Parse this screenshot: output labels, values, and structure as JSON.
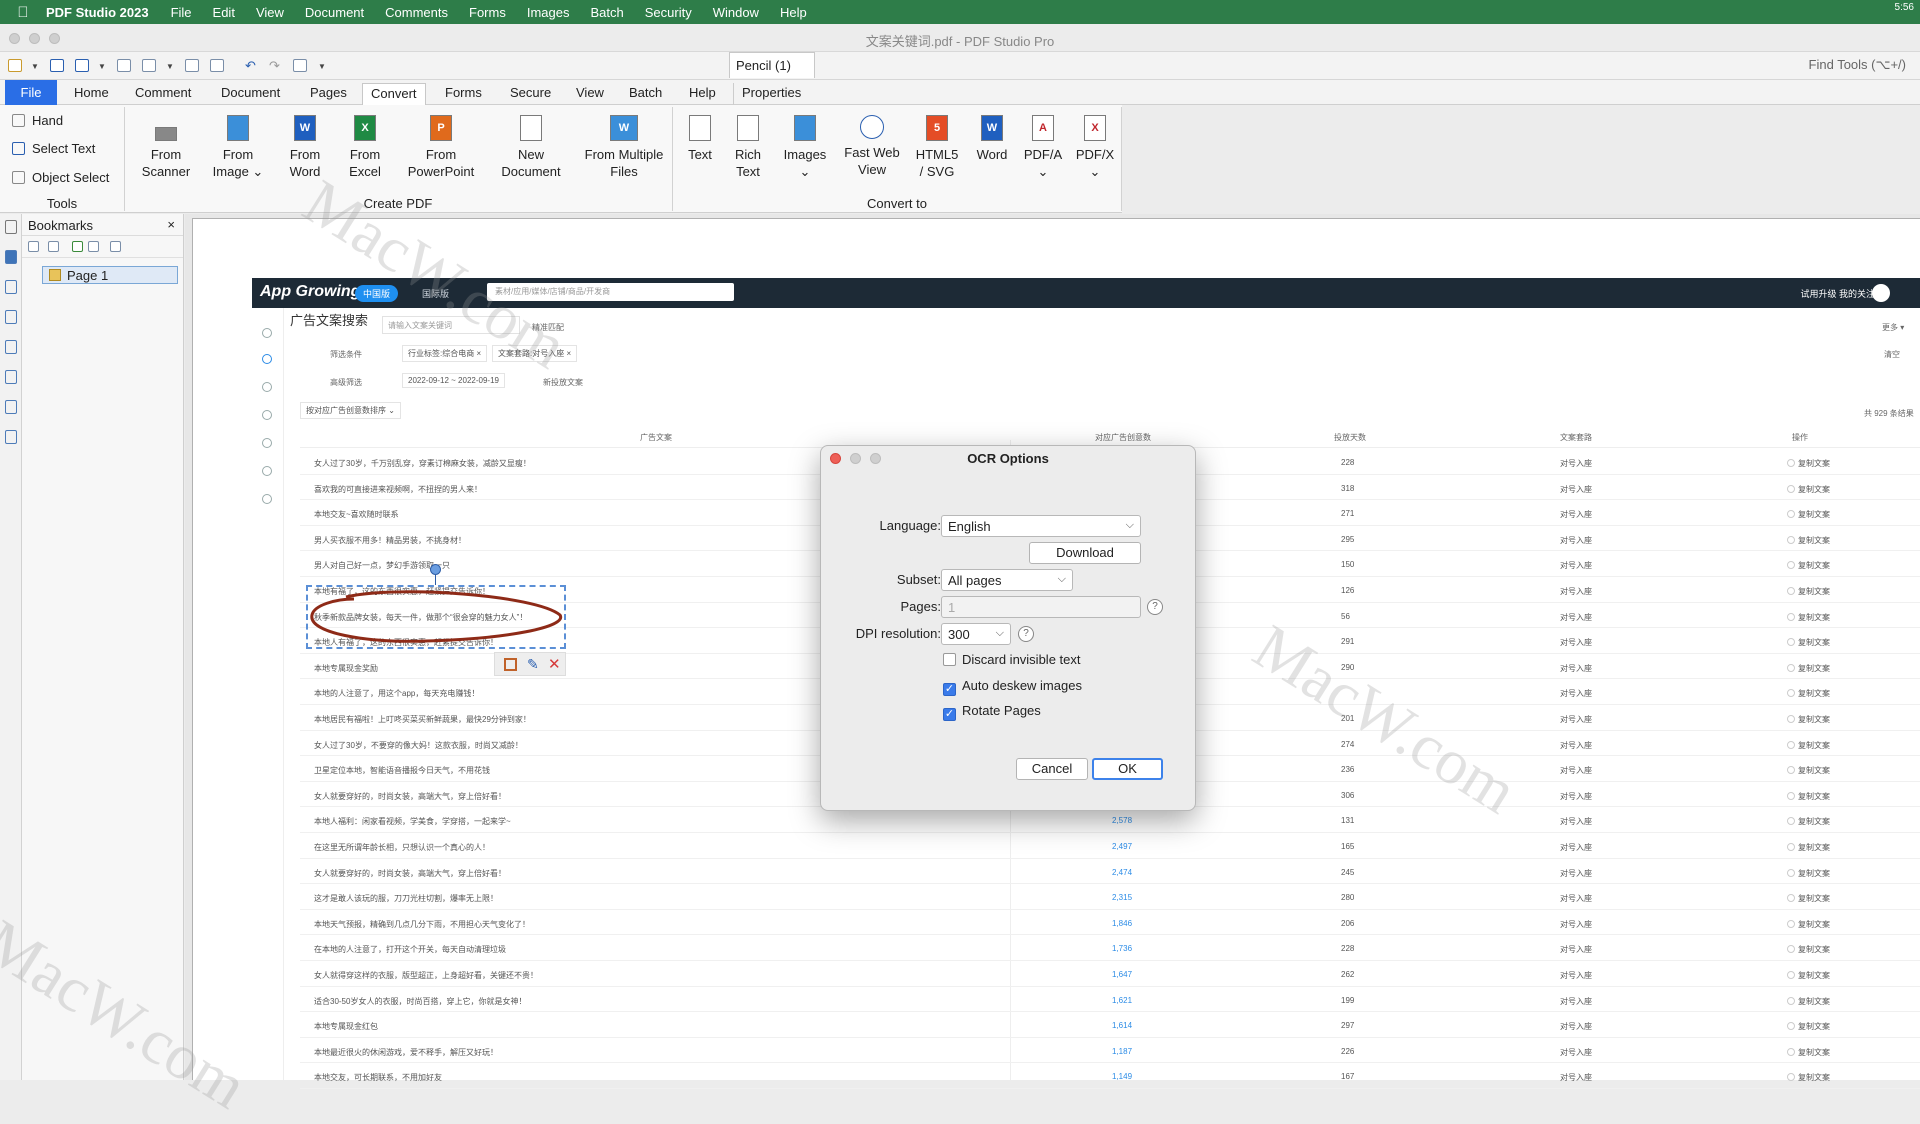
{
  "menubar": {
    "app_name": "PDF Studio 2023",
    "items": [
      "File",
      "Edit",
      "View",
      "Document",
      "Comments",
      "Forms",
      "Images",
      "Batch",
      "Security",
      "Window",
      "Help"
    ],
    "clock": "5:56"
  },
  "window": {
    "title": "文案关键词.pdf - PDF Studio Pro"
  },
  "quick": {
    "pencil_tab": "Pencil (1)",
    "find_tools": "Find Tools  (⌥+/)"
  },
  "tabs": [
    "File",
    "Home",
    "Comment",
    "Document",
    "Pages",
    "Convert",
    "Forms",
    "Secure",
    "View",
    "Batch",
    "Help",
    "Properties"
  ],
  "ribbon": {
    "tools": [
      "Hand",
      "Select Text",
      "Object Select"
    ],
    "tools_group": "Tools",
    "create_buttons": [
      {
        "line1": "From",
        "line2": "Scanner"
      },
      {
        "line1": "From",
        "line2": "Image ⌄"
      },
      {
        "line1": "From",
        "line2": "Word"
      },
      {
        "line1": "From",
        "line2": "Excel"
      },
      {
        "line1": "From",
        "line2": "PowerPoint"
      },
      {
        "line1": "New",
        "line2": "Document"
      },
      {
        "line1": "From Multiple",
        "line2": "Files"
      }
    ],
    "create_group": "Create PDF",
    "convert_buttons": [
      {
        "line1": "Text",
        "line2": ""
      },
      {
        "line1": "Rich",
        "line2": "Text"
      },
      {
        "line1": "Images",
        "line2": "⌄"
      },
      {
        "line1": "Fast Web",
        "line2": "View"
      },
      {
        "line1": "HTML5",
        "line2": "/ SVG"
      },
      {
        "line1": "Word",
        "line2": ""
      },
      {
        "line1": "PDF/A",
        "line2": "⌄"
      },
      {
        "line1": "PDF/X",
        "line2": "⌄"
      }
    ],
    "convert_group": "Convert to"
  },
  "bookmarks": {
    "title": "Bookmarks",
    "close": "×",
    "page_label": "Page 1"
  },
  "web": {
    "logo": "App Growing",
    "pill": "中国版",
    "intl": "国际版",
    "search_placeholder": "素材/应用/媒体/店铺/商品/开发商",
    "right_links": "试用升级   我的关注 ▾",
    "heading": "广告文案搜索",
    "input_placeholder": "请输入文案关键词",
    "toggle_label": "精准匹配",
    "more": "更多 ▾",
    "filter_label": "筛选条件",
    "filter_tags": [
      "行业标签:综合电商 ×",
      "文案套路:对号入座 ×"
    ],
    "clear": "清空",
    "advanced_label": "高级筛选",
    "date_range": "2022-09-12 ~ 2022-09-19",
    "new_copy": "新投放文案",
    "sort": "按对应广告创意数排序 ⌄",
    "total": "共 929 条结果",
    "columns": [
      "广告文案",
      "对应广告创意数",
      "投放天数",
      "文案套路",
      "操作"
    ]
  },
  "rows": [
    {
      "text": "女人过了30岁，千万别乱穿，穿素订棉麻女装，减龄又显瘦！",
      "count": "",
      "days": "228",
      "type": "对号入座",
      "op": "复制文案"
    },
    {
      "text": "喜欢我的可直接进来视频啊，不扭捏的男人来！",
      "count": "",
      "days": "318",
      "type": "对号入座",
      "op": "复制文案"
    },
    {
      "text": "本地交友~喜欢随时联系",
      "count": "",
      "days": "271",
      "type": "对号入座",
      "op": "复制文案"
    },
    {
      "text": "男人买衣服不用多！精品男装，不挑身材！",
      "count": "",
      "days": "295",
      "type": "对号入座",
      "op": "复制文案"
    },
    {
      "text": "男人对自己好一点，梦幻手游领取一只",
      "count": "",
      "days": "150",
      "type": "对号入座",
      "op": "复制文案"
    },
    {
      "text": "本地有福了，这的东西很实惠，赶紧提交告诉你！",
      "count": "",
      "days": "126",
      "type": "对号入座",
      "op": "复制文案"
    },
    {
      "text": "秋季新款品牌女装，每天一件，做那个“很会穿的魅力女人”！",
      "count": "",
      "days": "56",
      "type": "对号入座",
      "op": "复制文案"
    },
    {
      "text": "本地人有福了，这的东西很实惠，赶紧提交告诉你！",
      "count": "",
      "days": "291",
      "type": "对号入座",
      "op": "复制文案"
    },
    {
      "text": "本地专属现金奖励",
      "count": "",
      "days": "290",
      "type": "对号入座",
      "op": "复制文案"
    },
    {
      "text": "本地的人注意了，用这个app，每天充电赚钱！",
      "count": "",
      "days": "",
      "type": "对号入座",
      "op": "复制文案"
    },
    {
      "text": "本地居民有福啦！上叮咚买菜买新鲜蔬果，最快29分钟到家！",
      "count": "",
      "days": "201",
      "type": "对号入座",
      "op": "复制文案"
    },
    {
      "text": "女人过了30岁，不要穿的像大妈！这款衣服，时尚又减龄！",
      "count": "",
      "days": "274",
      "type": "对号入座",
      "op": "复制文案"
    },
    {
      "text": "卫星定位本地，智能语音播报今日天气，不用花钱",
      "count": "",
      "days": "236",
      "type": "对号入座",
      "op": "复制文案"
    },
    {
      "text": "女人就要穿好的，时尚女装，高端大气，穿上倍好看！",
      "count": "",
      "days": "306",
      "type": "对号入座",
      "op": "复制文案"
    },
    {
      "text": "本地人福利：闲家看视频，学美食，学穿搭，一起来学~",
      "count": "2,578",
      "days": "131",
      "type": "对号入座",
      "op": "复制文案"
    },
    {
      "text": "在这里无所谓年龄长相，只想认识一个真心的人！",
      "count": "2,497",
      "days": "165",
      "type": "对号入座",
      "op": "复制文案"
    },
    {
      "text": "女人就要穿好的，时尚女装，高端大气，穿上倍好看！",
      "count": "2,474",
      "days": "245",
      "type": "对号入座",
      "op": "复制文案"
    },
    {
      "text": "这才是敢人该玩的服，刀刀光柱切割，爆率无上限！",
      "count": "2,315",
      "days": "280",
      "type": "对号入座",
      "op": "复制文案"
    },
    {
      "text": "本地天气预报，精确到几点几分下雨，不用担心天气变化了！",
      "count": "1,846",
      "days": "206",
      "type": "对号入座",
      "op": "复制文案"
    },
    {
      "text": "在本地的人注意了，打开这个开关，每天自动清理垃圾",
      "count": "1,736",
      "days": "228",
      "type": "对号入座",
      "op": "复制文案"
    },
    {
      "text": "女人就得穿这样的衣服，版型超正，上身超好看，关键还不贵！",
      "count": "1,647",
      "days": "262",
      "type": "对号入座",
      "op": "复制文案"
    },
    {
      "text": "适合30-50岁女人的衣服，时尚百搭，穿上它，你就是女神！",
      "count": "1,621",
      "days": "199",
      "type": "对号入座",
      "op": "复制文案"
    },
    {
      "text": "本地专属现金红包",
      "count": "1,614",
      "days": "297",
      "type": "对号入座",
      "op": "复制文案"
    },
    {
      "text": "本地最近很火的休闲游戏，爱不释手，解压又好玩！",
      "count": "1,187",
      "days": "226",
      "type": "对号入座",
      "op": "复制文案"
    },
    {
      "text": "本地交友，可长期联系，不用加好友",
      "count": "1,149",
      "days": "167",
      "type": "对号入座",
      "op": "复制文案"
    }
  ],
  "watermark": "MacW.com",
  "dialog": {
    "title": "OCR Options",
    "language_label": "Language:",
    "language_value": "English",
    "download_label": "Download",
    "subset_label": "Subset:",
    "subset_value": "All pages",
    "pages_label": "Pages:",
    "pages_value": "1",
    "dpi_label": "DPI resolution:",
    "dpi_value": "300",
    "help": "?",
    "checks": [
      {
        "label": "Discard invisible text",
        "checked": false
      },
      {
        "label": "Auto deskew images",
        "checked": true
      },
      {
        "label": "Rotate Pages",
        "checked": true
      }
    ],
    "cancel_label": "Cancel",
    "ok_label": "OK"
  }
}
